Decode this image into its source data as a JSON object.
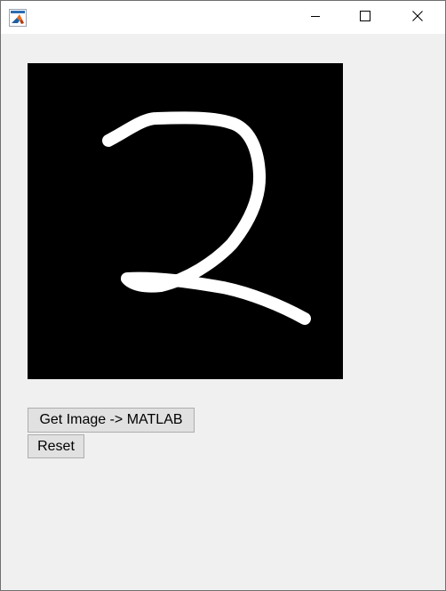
{
  "window": {
    "title": "",
    "icon": "matlab-icon",
    "controls": {
      "minimize_icon": "minimize-icon",
      "maximize_icon": "maximize-icon",
      "close_icon": "close-icon"
    }
  },
  "drawing": {
    "background_color": "#000000",
    "stroke_color": "#ffffff",
    "content": "handwritten digit"
  },
  "buttons": {
    "get_image_label": "Get Image -> MATLAB",
    "reset_label": "Reset"
  }
}
